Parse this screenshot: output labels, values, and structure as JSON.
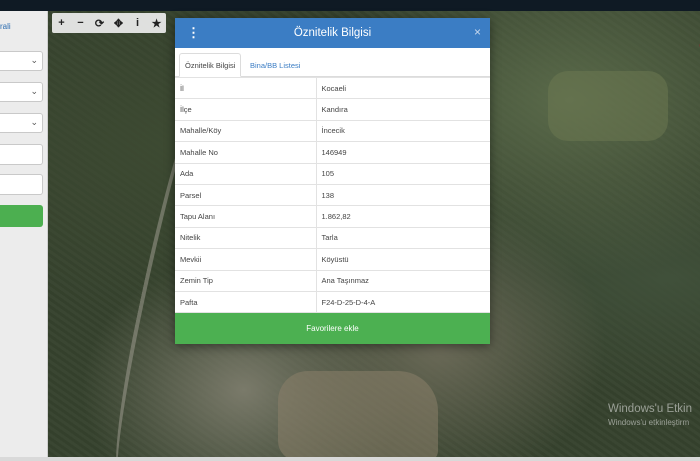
{
  "sidebar": {
    "link_fragment": "rali"
  },
  "toolbar": {
    "tools": [
      {
        "name": "zoom-in-icon",
        "glyph": "+"
      },
      {
        "name": "zoom-out-icon",
        "glyph": "−"
      },
      {
        "name": "refresh-icon",
        "glyph": "⟳"
      },
      {
        "name": "locate-icon",
        "glyph": "✥"
      },
      {
        "name": "info-icon",
        "glyph": "i"
      },
      {
        "name": "star-icon",
        "glyph": "★"
      }
    ]
  },
  "modal": {
    "title": "Öznitelik Bilgisi",
    "close_glyph": "×",
    "menu_glyph": "⋮",
    "tabs": [
      {
        "label": "Öznitelik Bilgisi",
        "active": true
      },
      {
        "label": "Bina/BB Listesi",
        "active": false
      }
    ],
    "rows": [
      {
        "key": "İl",
        "value": "Kocaeli"
      },
      {
        "key": "İlçe",
        "value": "Kandıra"
      },
      {
        "key": "Mahalle/Köy",
        "value": "İncecik"
      },
      {
        "key": "Mahalle No",
        "value": "146949"
      },
      {
        "key": "Ada",
        "value": "105"
      },
      {
        "key": "Parsel",
        "value": "138"
      },
      {
        "key": "Tapu Alanı",
        "value": "1.862,82"
      },
      {
        "key": "Nitelik",
        "value": "Tarla"
      },
      {
        "key": "Mevkii",
        "value": "Köyüstü"
      },
      {
        "key": "Zemin Tip",
        "value": "Ana Taşınmaz"
      },
      {
        "key": "Pafta",
        "value": "F24-D-25-D-4-A"
      }
    ],
    "favorite_button": "Favorilere ekle"
  },
  "watermark": {
    "line1": "Windows'u Etkin",
    "line2": "Windows'u etkinleştirm"
  },
  "colors": {
    "header": "#3b7dc4",
    "button": "#4cb051"
  }
}
